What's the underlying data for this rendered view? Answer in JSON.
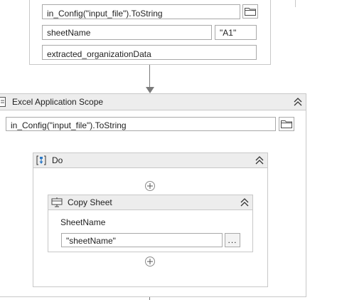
{
  "top_card": {
    "input_file_value": "in_Config(\"input_file\").ToString",
    "sheet_name_value": "sheetName",
    "range_value": "\"A1\"",
    "output_value": "extracted_organizationData"
  },
  "excel_scope": {
    "title": "Excel Application Scope",
    "workbook_path_value": "in_Config(\"input_file\").ToString"
  },
  "do_sequence": {
    "title": "Do"
  },
  "copy_sheet": {
    "title": "Copy Sheet",
    "sheet_name_label": "SheetName",
    "sheet_name_value": "\"sheetName\"",
    "ellipsis_label": "..."
  },
  "icons": {
    "folder": "folder-icon",
    "collapse": "chevron-double-up-icon",
    "add": "plus-circle-icon",
    "excel_scope": "excel-scope-icon",
    "sequence": "sequence-icon",
    "copy_sheet": "copy-sheet-icon"
  }
}
